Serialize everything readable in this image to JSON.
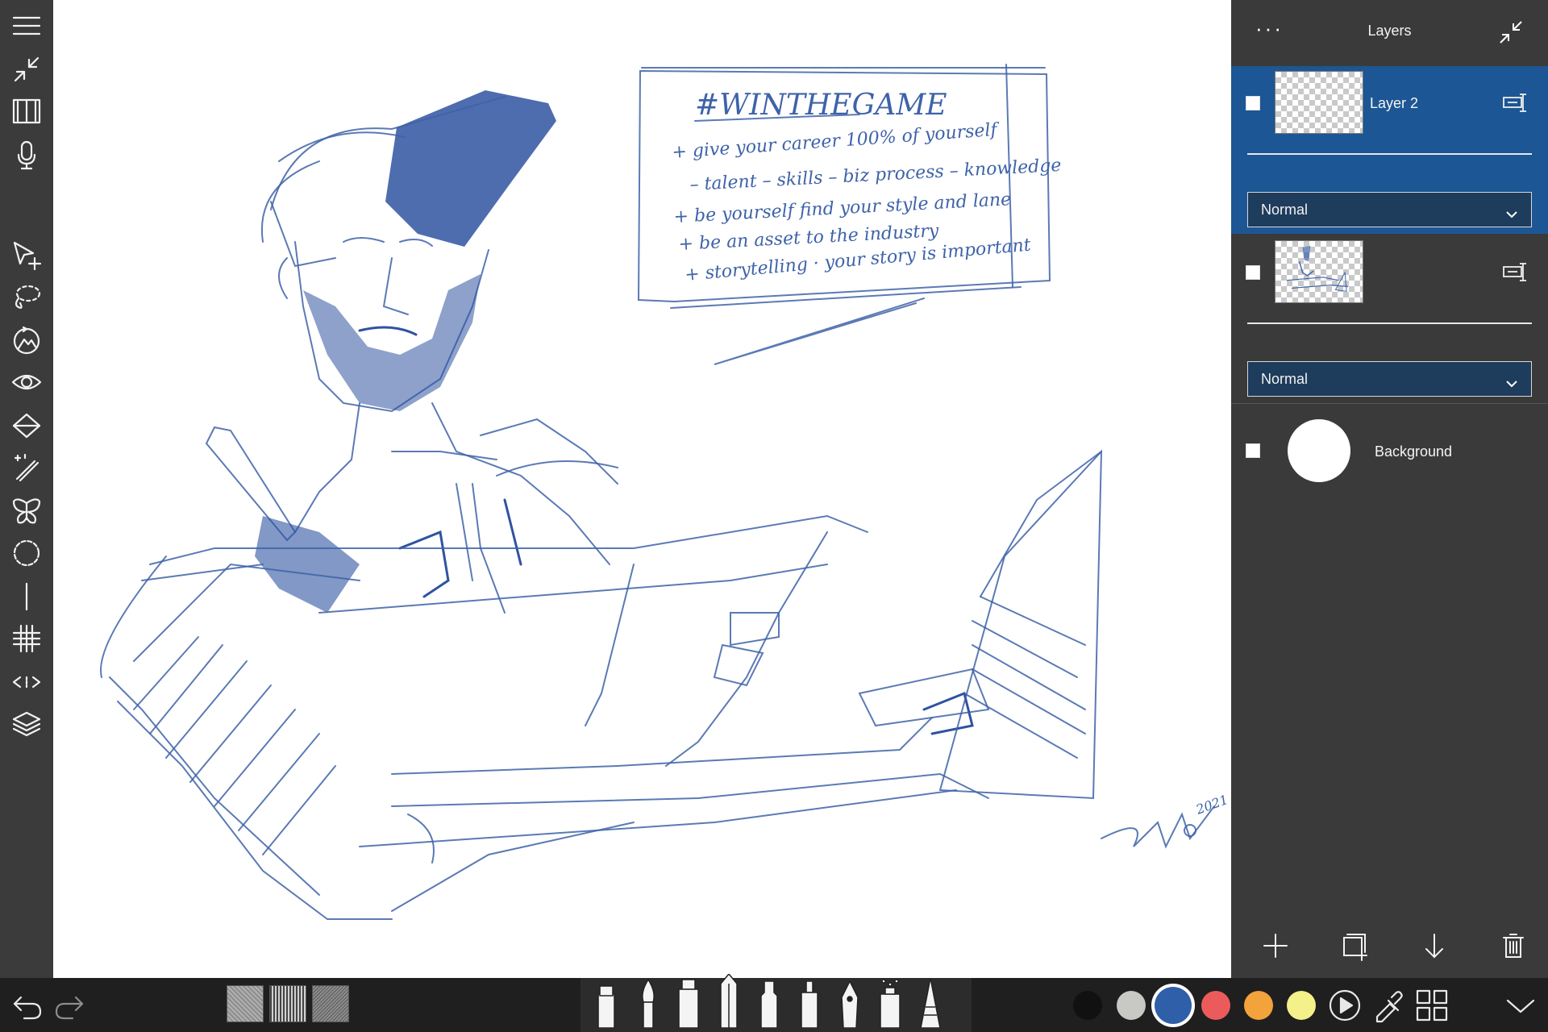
{
  "layers_panel": {
    "title": "Layers",
    "more_label": "···",
    "layers": [
      {
        "name": "Layer 2",
        "blend_mode": "Normal",
        "selected": true
      },
      {
        "name": "",
        "blend_mode": "Normal",
        "selected": false
      },
      {
        "name": "Background",
        "selected": false
      }
    ]
  },
  "canvas": {
    "note": {
      "title": "#WINTHEGAME",
      "lines": [
        "+ give your career 100% of yourself",
        "– talent – skills – biz process – knowledge",
        "+ be yourself find your style and lane",
        "+ be an asset to the industry",
        "+ storytelling · your story is important"
      ]
    },
    "signature_year": "2021"
  },
  "colors": {
    "accent": "#1d5694",
    "ink": "#3e63a8",
    "swatches": [
      "#111111",
      "#c8c8c4",
      "#2f5fa8",
      "#ec5b5b",
      "#f3a33c",
      "#f4f08a"
    ],
    "active_swatch": 2
  },
  "icons": {
    "left_toolbar": [
      "menu-icon",
      "collapse-icon",
      "reference-book-icon",
      "microphone-icon",
      "transform-icon",
      "lasso-icon",
      "crop-rotate-icon",
      "eye-icon",
      "fill-bucket-icon",
      "magic-wand-icon",
      "symmetry-butterfly-icon",
      "ellipse-guide-icon",
      "line-guide-icon",
      "grid-icon",
      "perspective-icon",
      "layers-icon"
    ]
  }
}
